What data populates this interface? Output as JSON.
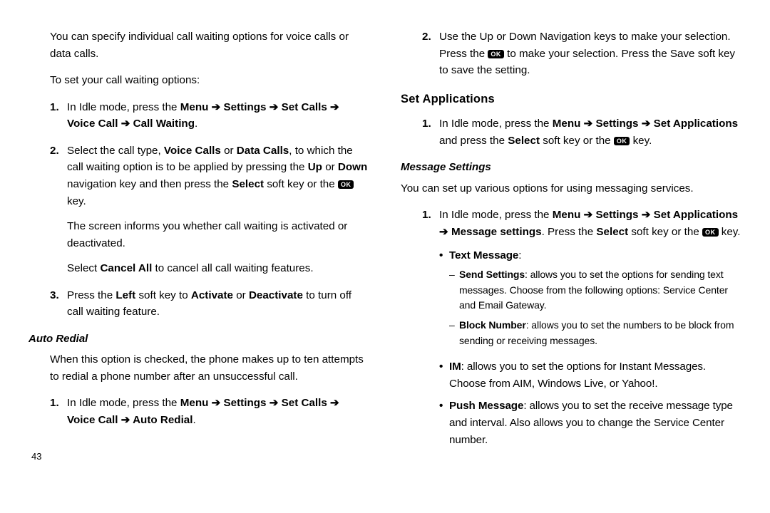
{
  "pageNumber": "43",
  "ok": "OK",
  "arrow": "➔",
  "left": {
    "intro1": "You can specify individual call waiting options for voice calls or data calls.",
    "intro2": "To set your call waiting options:",
    "item1_pre": "In Idle mode, press the ",
    "item1_b1": "Menu ",
    "item1_b2": " Settings ",
    "item1_b3": " Set Calls ",
    "item1_b4": " Voice Call ",
    "item1_b5": " Call Waiting",
    "item1_end": ".",
    "item2_a": "Select the call type, ",
    "item2_b1": "Voice Calls",
    "item2_mid1": " or ",
    "item2_b2": "Data Calls",
    "item2_mid2": ", to which the call waiting option is to be applied by pressing the ",
    "item2_b3": "Up",
    "item2_mid3": " or ",
    "item2_b4": "Down",
    "item2_mid4": " navigation key and then press the ",
    "item2_b5": "Select",
    "item2_mid5": " soft key or the ",
    "item2_end": " key.",
    "item2_p2": "The screen informs you whether call waiting is activated or deactivated.",
    "item2_p3a": "Select ",
    "item2_p3b": "Cancel All",
    "item2_p3c": " to cancel all call waiting features.",
    "item3_a": "Press the ",
    "item3_b1": "Left",
    "item3_mid1": " soft key to ",
    "item3_b2": "Activate",
    "item3_mid2": " or ",
    "item3_b3": "Deactivate",
    "item3_end": " to turn off call waiting feature.",
    "autoRedial_h": "Auto Redial",
    "autoRedial_p": "When this option is checked, the phone makes up to ten attempts to redial a phone number after an unsuccessful call.",
    "ar_item1_pre": "In Idle mode, press the ",
    "ar_item1_b1": "Menu ",
    "ar_item1_b2": " Settings ",
    "ar_item1_b3": " Set Calls ",
    "ar_item1_b4": " Voice Call ",
    "ar_item1_b5": " Auto Redial",
    "ar_item1_end": "."
  },
  "right": {
    "top2_a": "Use the Up or Down Navigation keys to make your selection. Press the ",
    "top2_b": " to make your selection. Press the Save soft key to save the setting.",
    "setApps_h": "Set Applications",
    "sa1_a": "In Idle mode, press the ",
    "sa1_b1": "Menu ",
    "sa1_b2": " Settings ",
    "sa1_b3": " Set Applications",
    "sa1_mid": " and press the ",
    "sa1_b4": "Select",
    "sa1_mid2": " soft key or the ",
    "sa1_end": " key.",
    "msg_h": "Message Settings",
    "msg_p": "You can set up various options for using messaging services.",
    "m1_a": "In Idle mode, press the ",
    "m1_b1": "Menu ",
    "m1_b2": " Settings ",
    "m1_b3": " Set Applications ",
    "m1_b4": " Message settings",
    "m1_mid": ". Press the ",
    "m1_b5": "Select",
    "m1_mid2": " soft key or the ",
    "m1_end": " key.",
    "bul_text_b": "Text Message",
    "bul_text_colon": ":",
    "sub_send_b": "Send Settings",
    "sub_send_rest": ": allows you to set the options for sending text messages. Choose from the following options: Service Center and Email Gateway.",
    "sub_block_b": "Block Number",
    "sub_block_rest": ": allows you to set the numbers to be block from sending or receiving messages.",
    "bul_im_b": "IM",
    "bul_im_rest": ": allows you to set the options for Instant Messages. Choose from AIM, Windows Live, or Yahoo!.",
    "bul_push_b": "Push Message",
    "bul_push_rest": ": allows you to set the receive message type and interval. Also allows you to change the Service Center number."
  }
}
